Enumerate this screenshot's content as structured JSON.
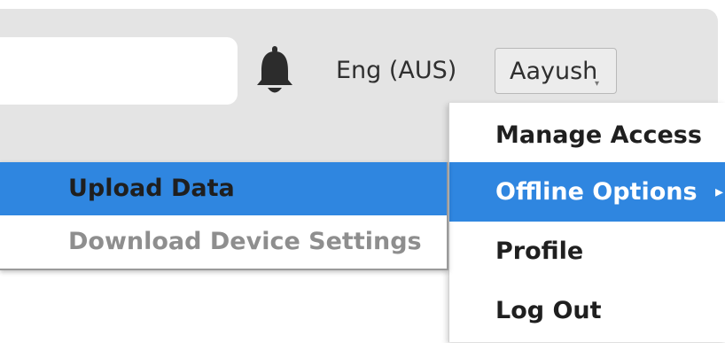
{
  "header": {
    "search": {
      "value": "",
      "placeholder": ""
    },
    "notification_icon": "bell-icon",
    "language": "Eng (AUS)",
    "user_button": {
      "label": "Aayush"
    }
  },
  "user_menu": {
    "items": [
      {
        "label": "Manage Access",
        "active": false
      },
      {
        "label": "Offline Options",
        "active": true,
        "has_submenu": true
      },
      {
        "label": "Profile",
        "active": false
      },
      {
        "label": "Log Out",
        "active": false
      }
    ]
  },
  "offline_submenu": {
    "items": [
      {
        "label": "Upload Data",
        "state": "highlighted"
      },
      {
        "label": "Download Device Settings",
        "state": "disabled"
      }
    ]
  },
  "colors": {
    "highlight": "#2f86e0",
    "header_bg": "#e4e4e4",
    "disabled_text": "#8e8e8e"
  }
}
